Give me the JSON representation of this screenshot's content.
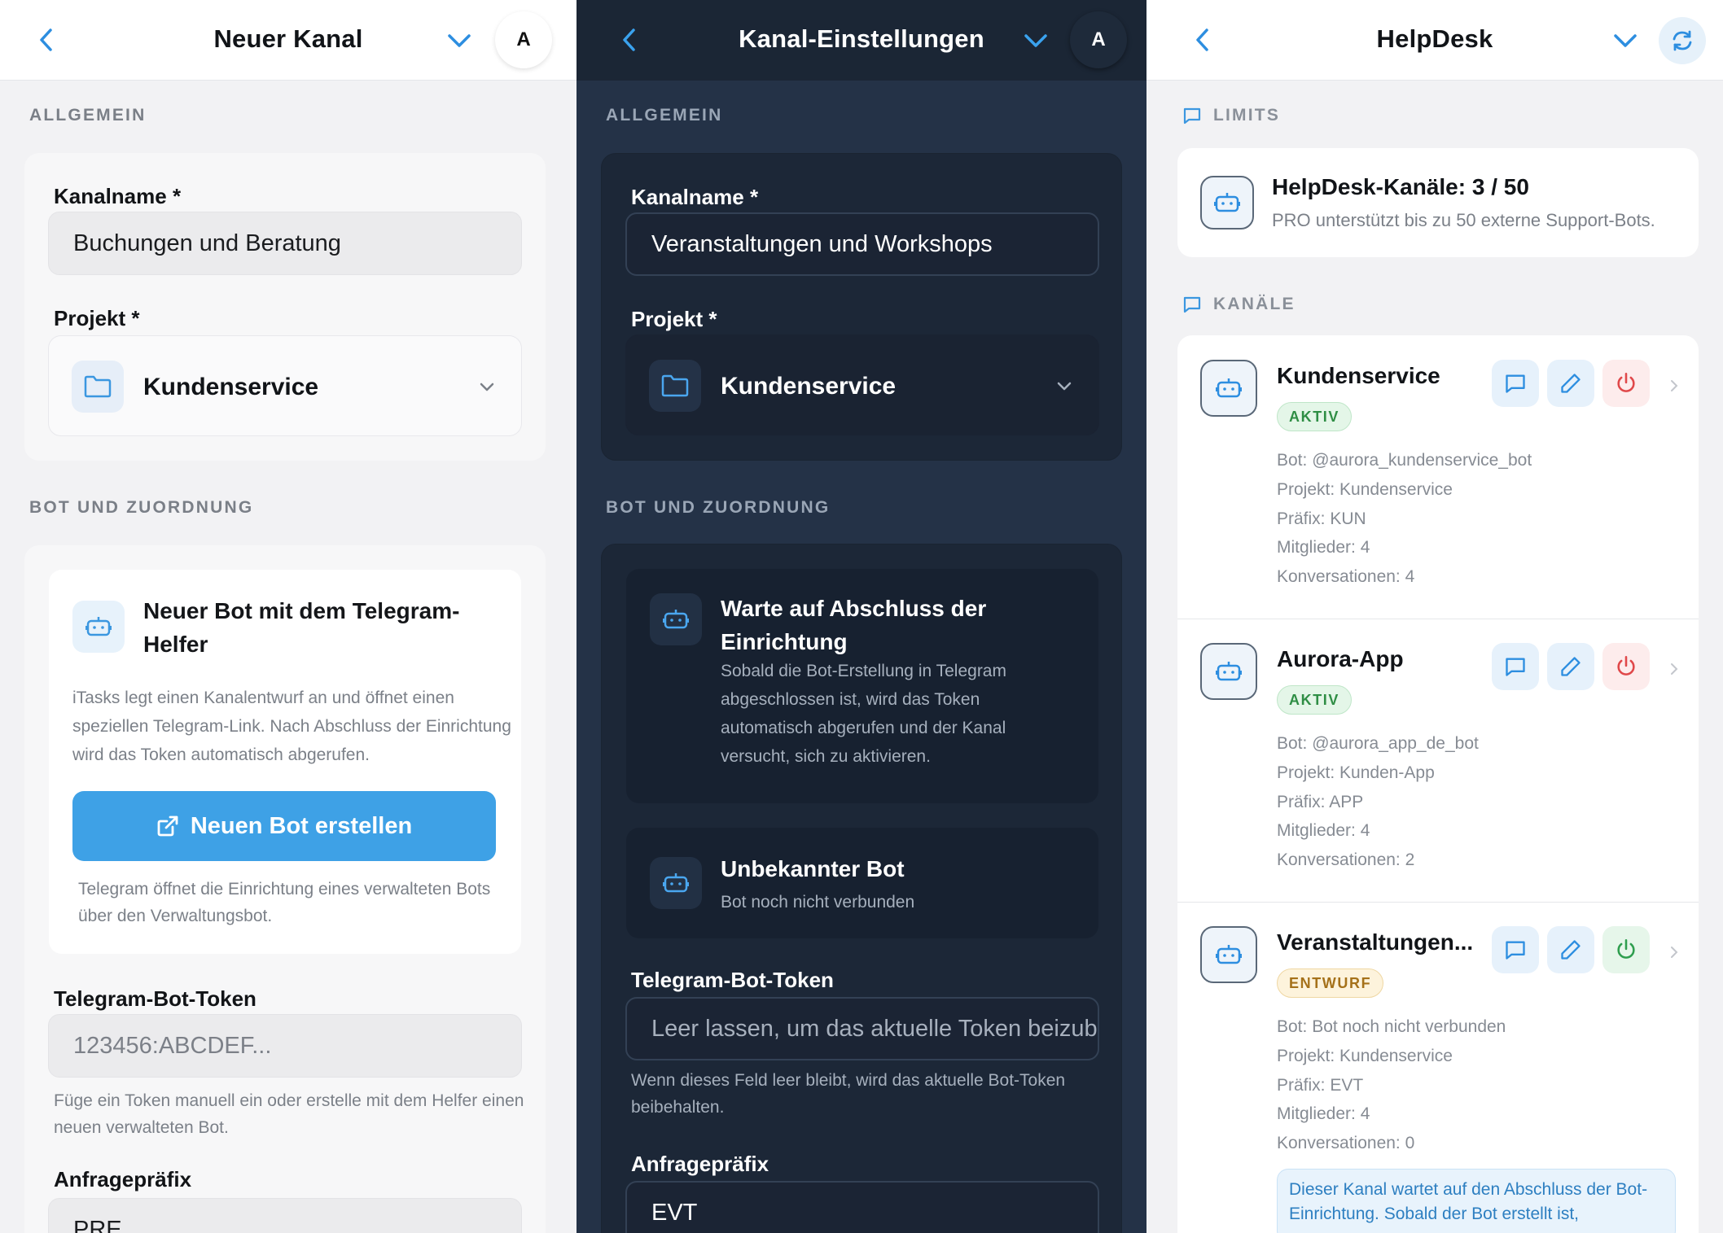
{
  "panel_left": {
    "header": {
      "title": "Neuer Kanal",
      "avatar_letter": "A"
    },
    "section_general": "ALLGEMEIN",
    "channel_name_label": "Kanalname *",
    "channel_name_value": "Buchungen und Beratung",
    "project_label": "Projekt *",
    "project_value": "Kundenservice",
    "section_bot": "BOT UND ZUORDNUNG",
    "helper_card": {
      "title": "Neuer Bot mit dem Telegram-Helfer",
      "description": "iTasks legt einen Kanalentwurf an und öffnet einen speziellen Telegram-Link. Nach Abschluss der Einrichtung wird das Token automatisch abgerufen.",
      "button_label": "Neuen Bot erstellen",
      "hint": "Telegram öffnet die Einrichtung eines verwalteten Bots über den Verwaltungsbot."
    },
    "token_label": "Telegram-Bot-Token",
    "token_placeholder": "123456:ABCDEF...",
    "token_hint": "Füge ein Token manuell ein oder erstelle mit dem Helfer einen neuen verwalteten Bot.",
    "prefix_label": "Anfragepräfix",
    "prefix_placeholder": "PRE"
  },
  "panel_middle": {
    "header": {
      "title": "Kanal-Einstellungen",
      "avatar_letter": "A"
    },
    "section_general": "ALLGEMEIN",
    "channel_name_label": "Kanalname *",
    "channel_name_value": "Veranstaltungen und Workshops",
    "project_label": "Projekt *",
    "project_value": "Kundenservice",
    "section_bot": "BOT UND ZUORDNUNG",
    "waiting_card": {
      "title": "Warte auf Abschluss der Einrichtung",
      "description": "Sobald die Bot-Erstellung in Telegram abgeschlossen ist, wird das Token automatisch abgerufen und der Kanal versucht, sich zu aktivieren."
    },
    "unknown_bot_card": {
      "title": "Unbekannter Bot",
      "subtitle": "Bot noch nicht verbunden"
    },
    "token_label": "Telegram-Bot-Token",
    "token_placeholder": "Leer lassen, um das aktuelle Token beizubehalten",
    "token_hint": "Wenn dieses Feld leer bleibt, wird das aktuelle Bot-Token beibehalten.",
    "prefix_label": "Anfragepräfix",
    "prefix_value": "EVT"
  },
  "panel_right": {
    "header": {
      "title": "HelpDesk"
    },
    "section_limits": "LIMITS",
    "limits": {
      "title": "HelpDesk-Kanäle: 3 / 50",
      "subtitle": "PRO unterstützt bis zu 50 externe Support-Bots."
    },
    "section_channels": "KANÄLE",
    "channels": [
      {
        "name": "Kundenservice",
        "status": "AKTIV",
        "bot": "Bot: @aurora_kundenservice_bot",
        "project": "Projekt: Kundenservice",
        "prefix": "Präfix: KUN",
        "members": "Mitglieder: 4",
        "conversations": "Konversationen: 4"
      },
      {
        "name": "Aurora-App",
        "status": "AKTIV",
        "bot": "Bot: @aurora_app_de_bot",
        "project": "Projekt: Kunden-App",
        "prefix": "Präfix: APP",
        "members": "Mitglieder: 4",
        "conversations": "Konversationen: 2"
      },
      {
        "name": "Veranstaltungen...",
        "status": "ENTWURF",
        "bot": "Bot: Bot noch nicht verbunden",
        "project": "Projekt: Kundenservice",
        "prefix": "Präfix: EVT",
        "members": "Mitglieder: 4",
        "conversations": "Konversationen: 0",
        "note": "Dieser Kanal wartet auf den Abschluss der Bot-Einrichtung. Sobald der Bot erstellt ist,"
      }
    ]
  },
  "colors": {
    "accent": "#3ea1e6",
    "dark_panel": "#243247",
    "active_green": "#2f8e45",
    "draft_amber": "#a5711a",
    "danger_red": "#e0484a"
  }
}
